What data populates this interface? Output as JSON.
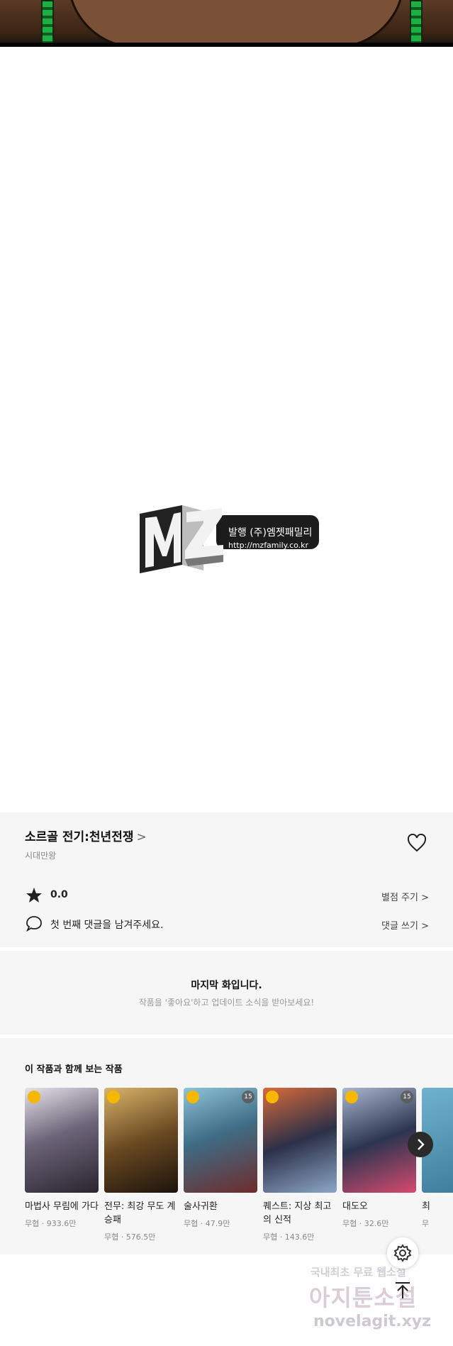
{
  "logo": {
    "line1": "발행 (주)엠젯패밀리",
    "line2": "http://mzfamily.co.kr"
  },
  "work": {
    "title": "소르골 전기:천년전쟁",
    "title_chevron": ">",
    "author": "시대만왕",
    "rating": "0.0",
    "rate_link": "별점 주기 >",
    "comment_prompt": "첫 번째 댓글을 남겨주세요.",
    "comment_link": "댓글 쓰기 >"
  },
  "last_episode": {
    "title": "마지막 화입니다.",
    "subtitle": "작품을 '좋아요'하고 업데이트 소식을 받아보세요!"
  },
  "recommendations": {
    "heading": "이 작품과 함께 보는 작품",
    "items": [
      {
        "title": "마법사 무림에 가다",
        "meta": "무협 · 933.6만",
        "age": "",
        "color": "#4a4450"
      },
      {
        "title": "전무: 최강 무도 계승패",
        "meta": "무협 · 576.5만",
        "age": "",
        "color": "#6b4a22"
      },
      {
        "title": "술사귀환",
        "meta": "무협 · 47.9만",
        "age": "15",
        "color": "#3f6c86"
      },
      {
        "title": "퀘스트: 지상 최고의 신적",
        "meta": "무협 · 143.6만",
        "age": "",
        "color": "#2c3048"
      },
      {
        "title": "대도오",
        "meta": "무협 · 32.6만",
        "age": "15",
        "color": "#2b3550"
      },
      {
        "title": "최",
        "meta": "무",
        "age": "",
        "color": "#3a7896"
      }
    ]
  },
  "watermark": {
    "line1": "국내최초 무료 웹소설",
    "line2": "아지툰소설",
    "line3": "novelagit.xyz"
  }
}
